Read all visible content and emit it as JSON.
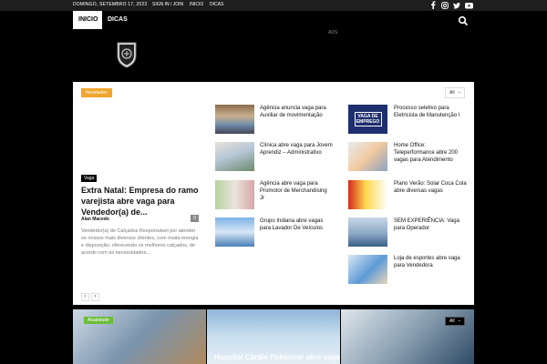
{
  "topbar": {
    "date": "DOMINGO, SETEMBRO 17, 2023",
    "links": [
      "SIGN IN / JOIN",
      "INICIO",
      "DICAS"
    ],
    "social": [
      "facebook-icon",
      "instagram-icon",
      "twitter-icon",
      "youtube-icon"
    ]
  },
  "nav": {
    "items": [
      "INICIO",
      "DICAS"
    ],
    "search_icon": "search-icon"
  },
  "ads_label": "ADS",
  "panel": {
    "category": "Novidades",
    "filter": "All",
    "featured": {
      "category": "Vaga",
      "title": "Extra Natal: Empresa do ramo varejista abre vaga para Vendedor(a) de...",
      "author": "Alan Macedo",
      "comments": "0",
      "excerpt": "Vendedor(a) de Calçados Responsável por atender os nossos mais diversos clientes, com muita energia e disposição; oferecendo os melhores calçados, de acordo com as necessidades..."
    },
    "col1": [
      "Agência anuncia vaga para Auxiliar de movimentação",
      "Clínica abre vaga para Jovem Aprendiz – Administrativo",
      "Agência abre vaga para Promotor de Merchandising Jr",
      "Grupo Indiana abre vagas para Lavador De Veículos"
    ],
    "col2": [
      "Processo seletivo para Eletricista de Manutenção I",
      "Home Office: Teleperformance abre 200 vagas para Atendimento",
      "Plano Verão: Solar Coca Cola abre diversas vagas",
      "SEM EXPERIÊNCIA: Vaga para Operador",
      "Loja de esportes abre vaga para Vendedora"
    ],
    "thumb_text": "VAGA DE EMPREGO",
    "pager": [
      "‹",
      "›"
    ]
  },
  "bottom": {
    "badge": "Atualidade",
    "title": "Hospital Cárdio Pulmonar abre vagas",
    "filter": "All"
  },
  "colors": {
    "accent_orange": "#f0a52b",
    "accent_green": "#6bbd3a",
    "topbar": "#1e1e1e"
  }
}
